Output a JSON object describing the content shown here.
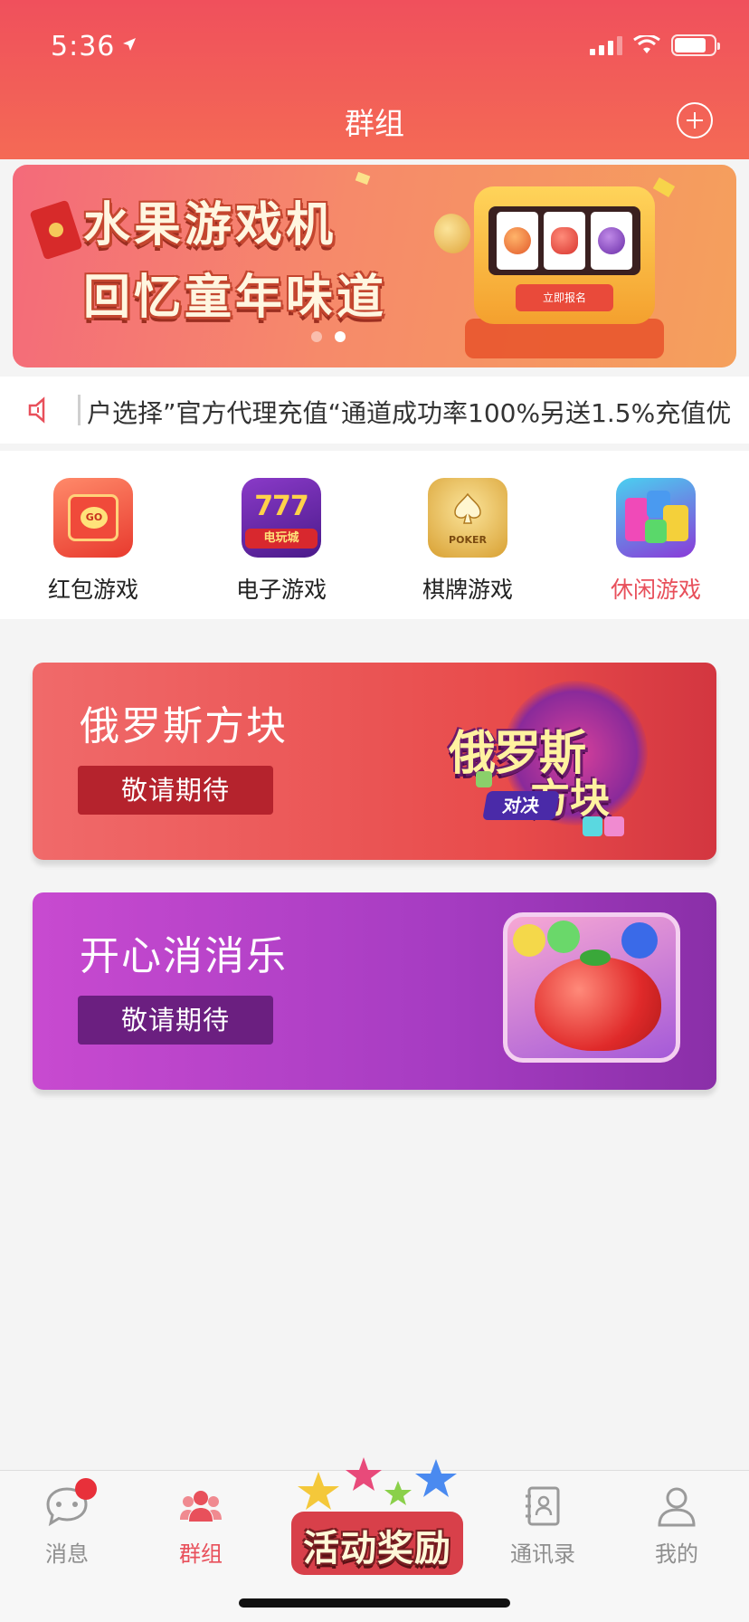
{
  "status_bar": {
    "time": "5:36"
  },
  "header": {
    "title": "群组"
  },
  "banner": {
    "line1": "水果游戏机",
    "line2": "回忆童年味道",
    "slot_button": "立即报名",
    "page_count": 2,
    "active_page": 2
  },
  "notice": {
    "text": "户选择”官方代理充值“通道成功率100%另送1.5%充值优"
  },
  "categories": [
    {
      "label": "红包游戏",
      "icon": "red-envelope-game-icon",
      "badge": "GO"
    },
    {
      "label": "电子游戏",
      "icon": "slot-777-game-icon",
      "badge": "电玩城"
    },
    {
      "label": "棋牌游戏",
      "icon": "poker-game-icon",
      "badge": "POKER"
    },
    {
      "label": "休闲游戏",
      "icon": "casual-game-icon",
      "label_color": "#e8505b"
    }
  ],
  "games": [
    {
      "title": "俄罗斯方块",
      "button": "敬请期待",
      "art_title_1": "俄罗斯",
      "art_title_2": "方块",
      "art_tag": "对决"
    },
    {
      "title": "开心消消乐",
      "button": "敬请期待"
    }
  ],
  "tabbar": {
    "items": [
      {
        "label": "消息",
        "icon": "chat-bubble-icon",
        "has_badge": true
      },
      {
        "label": "群组",
        "icon": "group-icon",
        "active": true
      },
      {
        "label": "通讯录",
        "icon": "contacts-icon"
      },
      {
        "label": "我的",
        "icon": "person-icon"
      }
    ],
    "promo": {
      "label": "活动奖励"
    }
  },
  "colors": {
    "header": "#f0505c",
    "accent": "#e8505b",
    "card1": "#e84b4b",
    "card2": "#a63cc2"
  }
}
